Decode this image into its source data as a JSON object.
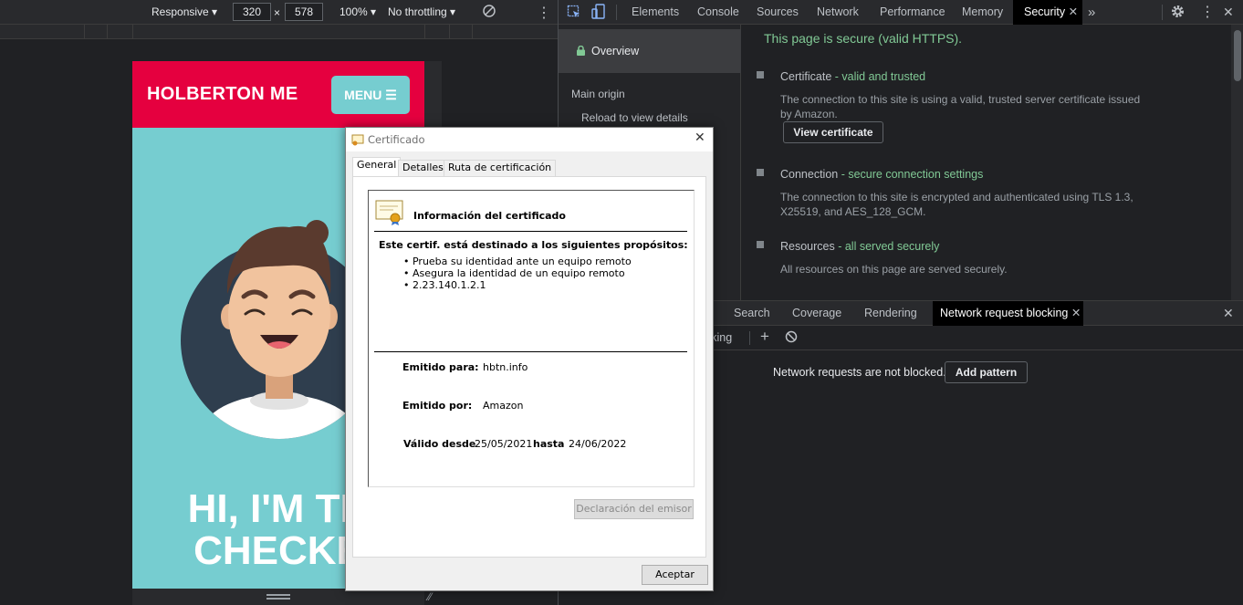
{
  "device_toolbar": {
    "device": "Responsive",
    "width": "320",
    "times": "×",
    "height": "578",
    "zoom": "100%",
    "throttling": "No throttling"
  },
  "website": {
    "brand": "HOLBERTON ME",
    "menu": "MENU",
    "hero_line1": "HI, I'M TH",
    "hero_line2": "CHECKE"
  },
  "devtools": {
    "tabs": [
      "Elements",
      "Console",
      "Sources",
      "Network",
      "Performance",
      "Memory",
      "Security"
    ],
    "active_tab": "Security",
    "more": "»",
    "sidebar": {
      "overview": "Overview",
      "main_origin": "Main origin",
      "reload": "Reload to view details"
    },
    "security": {
      "summary": "This page is secure (valid HTTPS).",
      "certificate_label": "Certificate",
      "certificate_status": " - valid and trusted",
      "certificate_desc": "The connection to this site is using a valid, trusted server certificate issued by Amazon.",
      "view_certificate": "View certificate",
      "connection_label": "Connection",
      "connection_status": " - secure connection settings",
      "connection_desc": "The connection to this site is encrypted and authenticated using TLS 1.3, X25519, and AES_128_GCM.",
      "resources_label": "Resources",
      "resources_status": " - all served securely",
      "resources_desc": "All resources on this page are served securely."
    },
    "drawer": {
      "tabs": [
        "Search",
        "Coverage",
        "Rendering",
        "Network request blocking"
      ],
      "active_tab": "Network request blocking",
      "toolbar_label": "cking",
      "message": "Network requests are not blocked.",
      "add_pattern": "Add pattern"
    }
  },
  "certificate_dialog": {
    "title": "Certificado",
    "tabs": [
      "General",
      "Detalles",
      "Ruta de certificación"
    ],
    "info_heading": "Información del certificado",
    "purpose_heading": "Este certif. está destinado a los siguientes propósitos:",
    "purposes": [
      "• Prueba su identidad ante un equipo remoto",
      "• Asegura la identidad de un equipo remoto",
      "• 2.23.140.1.2.1"
    ],
    "issued_to_label": "Emitido para:",
    "issued_to": "hbtn.info",
    "issued_by_label": "Emitido por:",
    "issued_by": "Amazon",
    "valid_from_label": "Válido desde",
    "valid_from": "25/05/2021",
    "valid_to_label": "hasta",
    "valid_to": "24/06/2022",
    "issuer_statement": "Declaración del emisor",
    "accept": "Aceptar"
  },
  "colors": {
    "site_header": "#e5003f",
    "site_bg": "#76cdd0",
    "secure_green": "#81c995"
  }
}
